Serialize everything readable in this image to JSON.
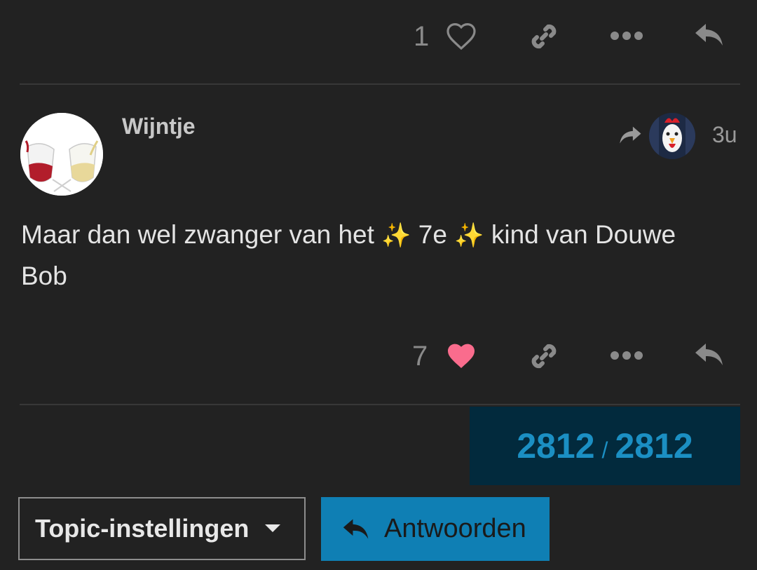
{
  "post_top": {
    "like_count": "1",
    "icons": [
      "heart-outline-icon",
      "link-icon",
      "more-icon",
      "reply-icon"
    ]
  },
  "post": {
    "username": "Wijntje",
    "time": "3u",
    "body_text_1": "Maar dan wel zwanger van het",
    "sparkle": "✨",
    "body_text_2": "7e",
    "body_text_3": "kind van Douwe",
    "body_text_4": "Bob",
    "like_count": "7",
    "icons": [
      "heart-filled-icon",
      "link-icon",
      "more-icon",
      "reply-icon"
    ]
  },
  "progress": {
    "current": "2812",
    "separator": "/",
    "total": "2812"
  },
  "footer": {
    "settings_label": "Topic-instellingen",
    "reply_label": "Antwoorden"
  },
  "colors": {
    "background": "#222222",
    "accent_blue": "#0f7fb4",
    "progress_bg": "#022a3d",
    "heart_pink": "#fa6c8d",
    "icon_gray": "#8a8a8a"
  }
}
